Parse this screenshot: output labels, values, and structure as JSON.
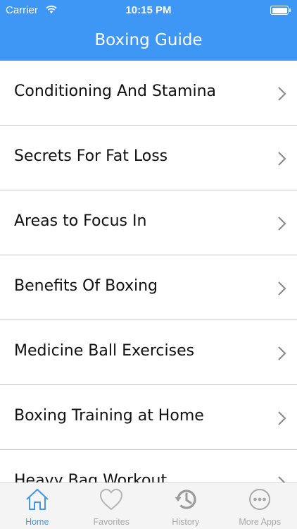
{
  "status_bar": {
    "carrier": "Carrier",
    "time": "10:15 PM",
    "wifi_icon": "wifi-icon",
    "battery_icon": "battery-icon"
  },
  "header": {
    "title": "Boxing Guide",
    "background_color": "#3f97f5"
  },
  "list": {
    "items": [
      {
        "label": "Conditioning And Stamina"
      },
      {
        "label": "Secrets For Fat Loss"
      },
      {
        "label": "Areas to Focus In"
      },
      {
        "label": "Benefits Of Boxing"
      },
      {
        "label": "Medicine Ball Exercises"
      },
      {
        "label": "Boxing Training at Home"
      },
      {
        "label": "Heavy Bag Workout"
      }
    ],
    "chevron_icon": "chevron-right-icon"
  },
  "tabbar": {
    "tabs": [
      {
        "label": "Home",
        "icon": "home-icon",
        "active": true
      },
      {
        "label": "Favorites",
        "icon": "heart-icon",
        "active": false
      },
      {
        "label": "History",
        "icon": "history-icon",
        "active": false
      },
      {
        "label": "More Apps",
        "icon": "more-icon",
        "active": false
      }
    ],
    "active_color": "#3f97f5",
    "inactive_color": "#a8a8a8"
  }
}
